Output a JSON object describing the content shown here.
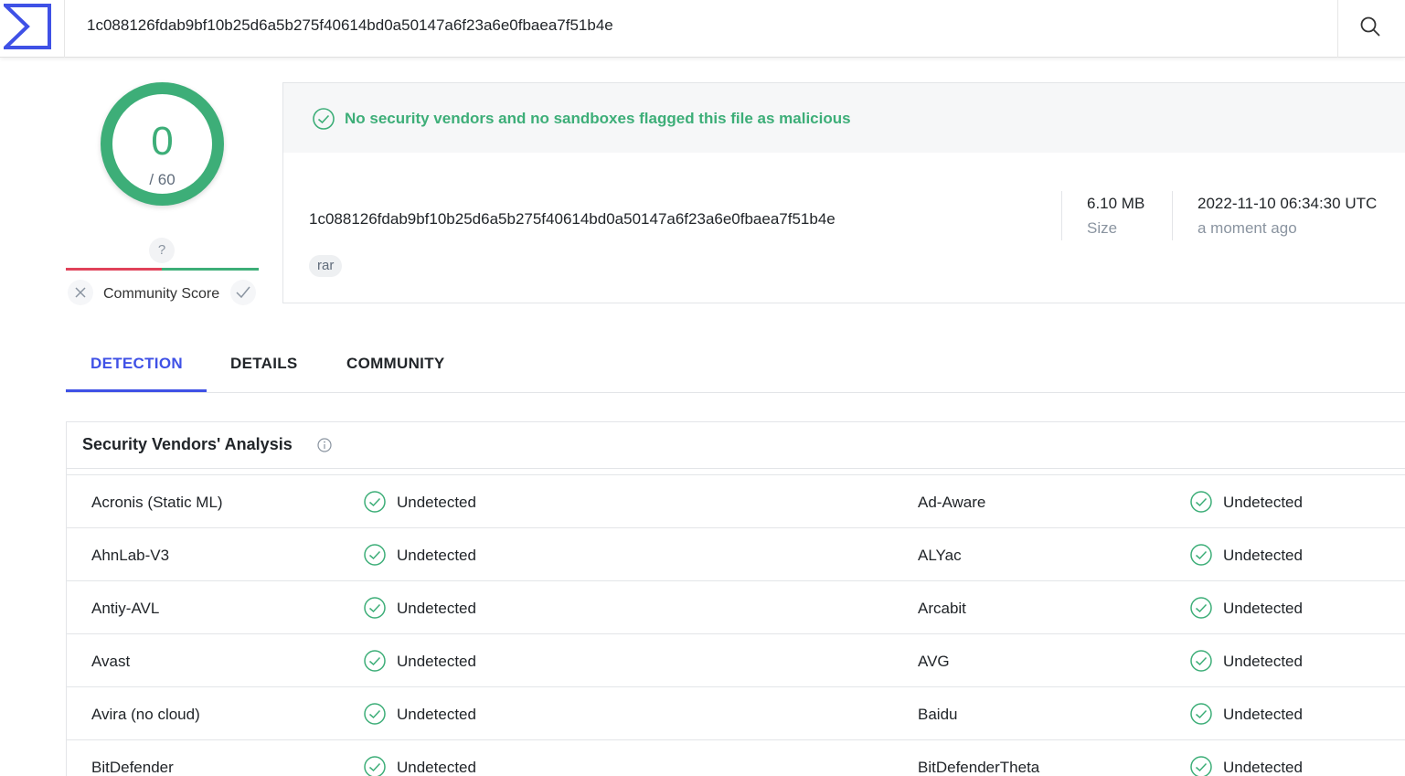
{
  "search": {
    "query": "1c088126fdab9bf10b25d6a5b275f40614bd0a50147a6f23a6e0fbaea7f51b4e"
  },
  "score": {
    "detections": "0",
    "total": "/ 60",
    "community_unknown": "?",
    "community_label": "Community Score"
  },
  "summary": {
    "banner": "No security vendors and no sandboxes flagged this file as malicious",
    "hash": "1c088126fdab9bf10b25d6a5b275f40614bd0a50147a6f23a6e0fbaea7f51b4e",
    "tag": "rar",
    "size_value": "6.10 MB",
    "size_label": "Size",
    "date_value": "2022-11-10 06:34:30 UTC",
    "date_ago": "a moment ago"
  },
  "tabs": [
    {
      "label": "DETECTION",
      "active": true
    },
    {
      "label": "DETAILS",
      "active": false
    },
    {
      "label": "COMMUNITY",
      "active": false
    }
  ],
  "vendors": {
    "title": "Security Vendors' Analysis",
    "rows": [
      {
        "left_name": "Acronis (Static ML)",
        "left_status": "Undetected",
        "right_name": "Ad-Aware",
        "right_status": "Undetected"
      },
      {
        "left_name": "AhnLab-V3",
        "left_status": "Undetected",
        "right_name": "ALYac",
        "right_status": "Undetected"
      },
      {
        "left_name": "Antiy-AVL",
        "left_status": "Undetected",
        "right_name": "Arcabit",
        "right_status": "Undetected"
      },
      {
        "left_name": "Avast",
        "left_status": "Undetected",
        "right_name": "AVG",
        "right_status": "Undetected"
      },
      {
        "left_name": "Avira (no cloud)",
        "left_status": "Undetected",
        "right_name": "Baidu",
        "right_status": "Undetected"
      },
      {
        "left_name": "BitDefender",
        "left_status": "Undetected",
        "right_name": "BitDefenderTheta",
        "right_status": "Undetected"
      }
    ]
  },
  "colors": {
    "accent": "#3f51e6",
    "clean": "#3dae78",
    "malicious": "#e0425a"
  }
}
